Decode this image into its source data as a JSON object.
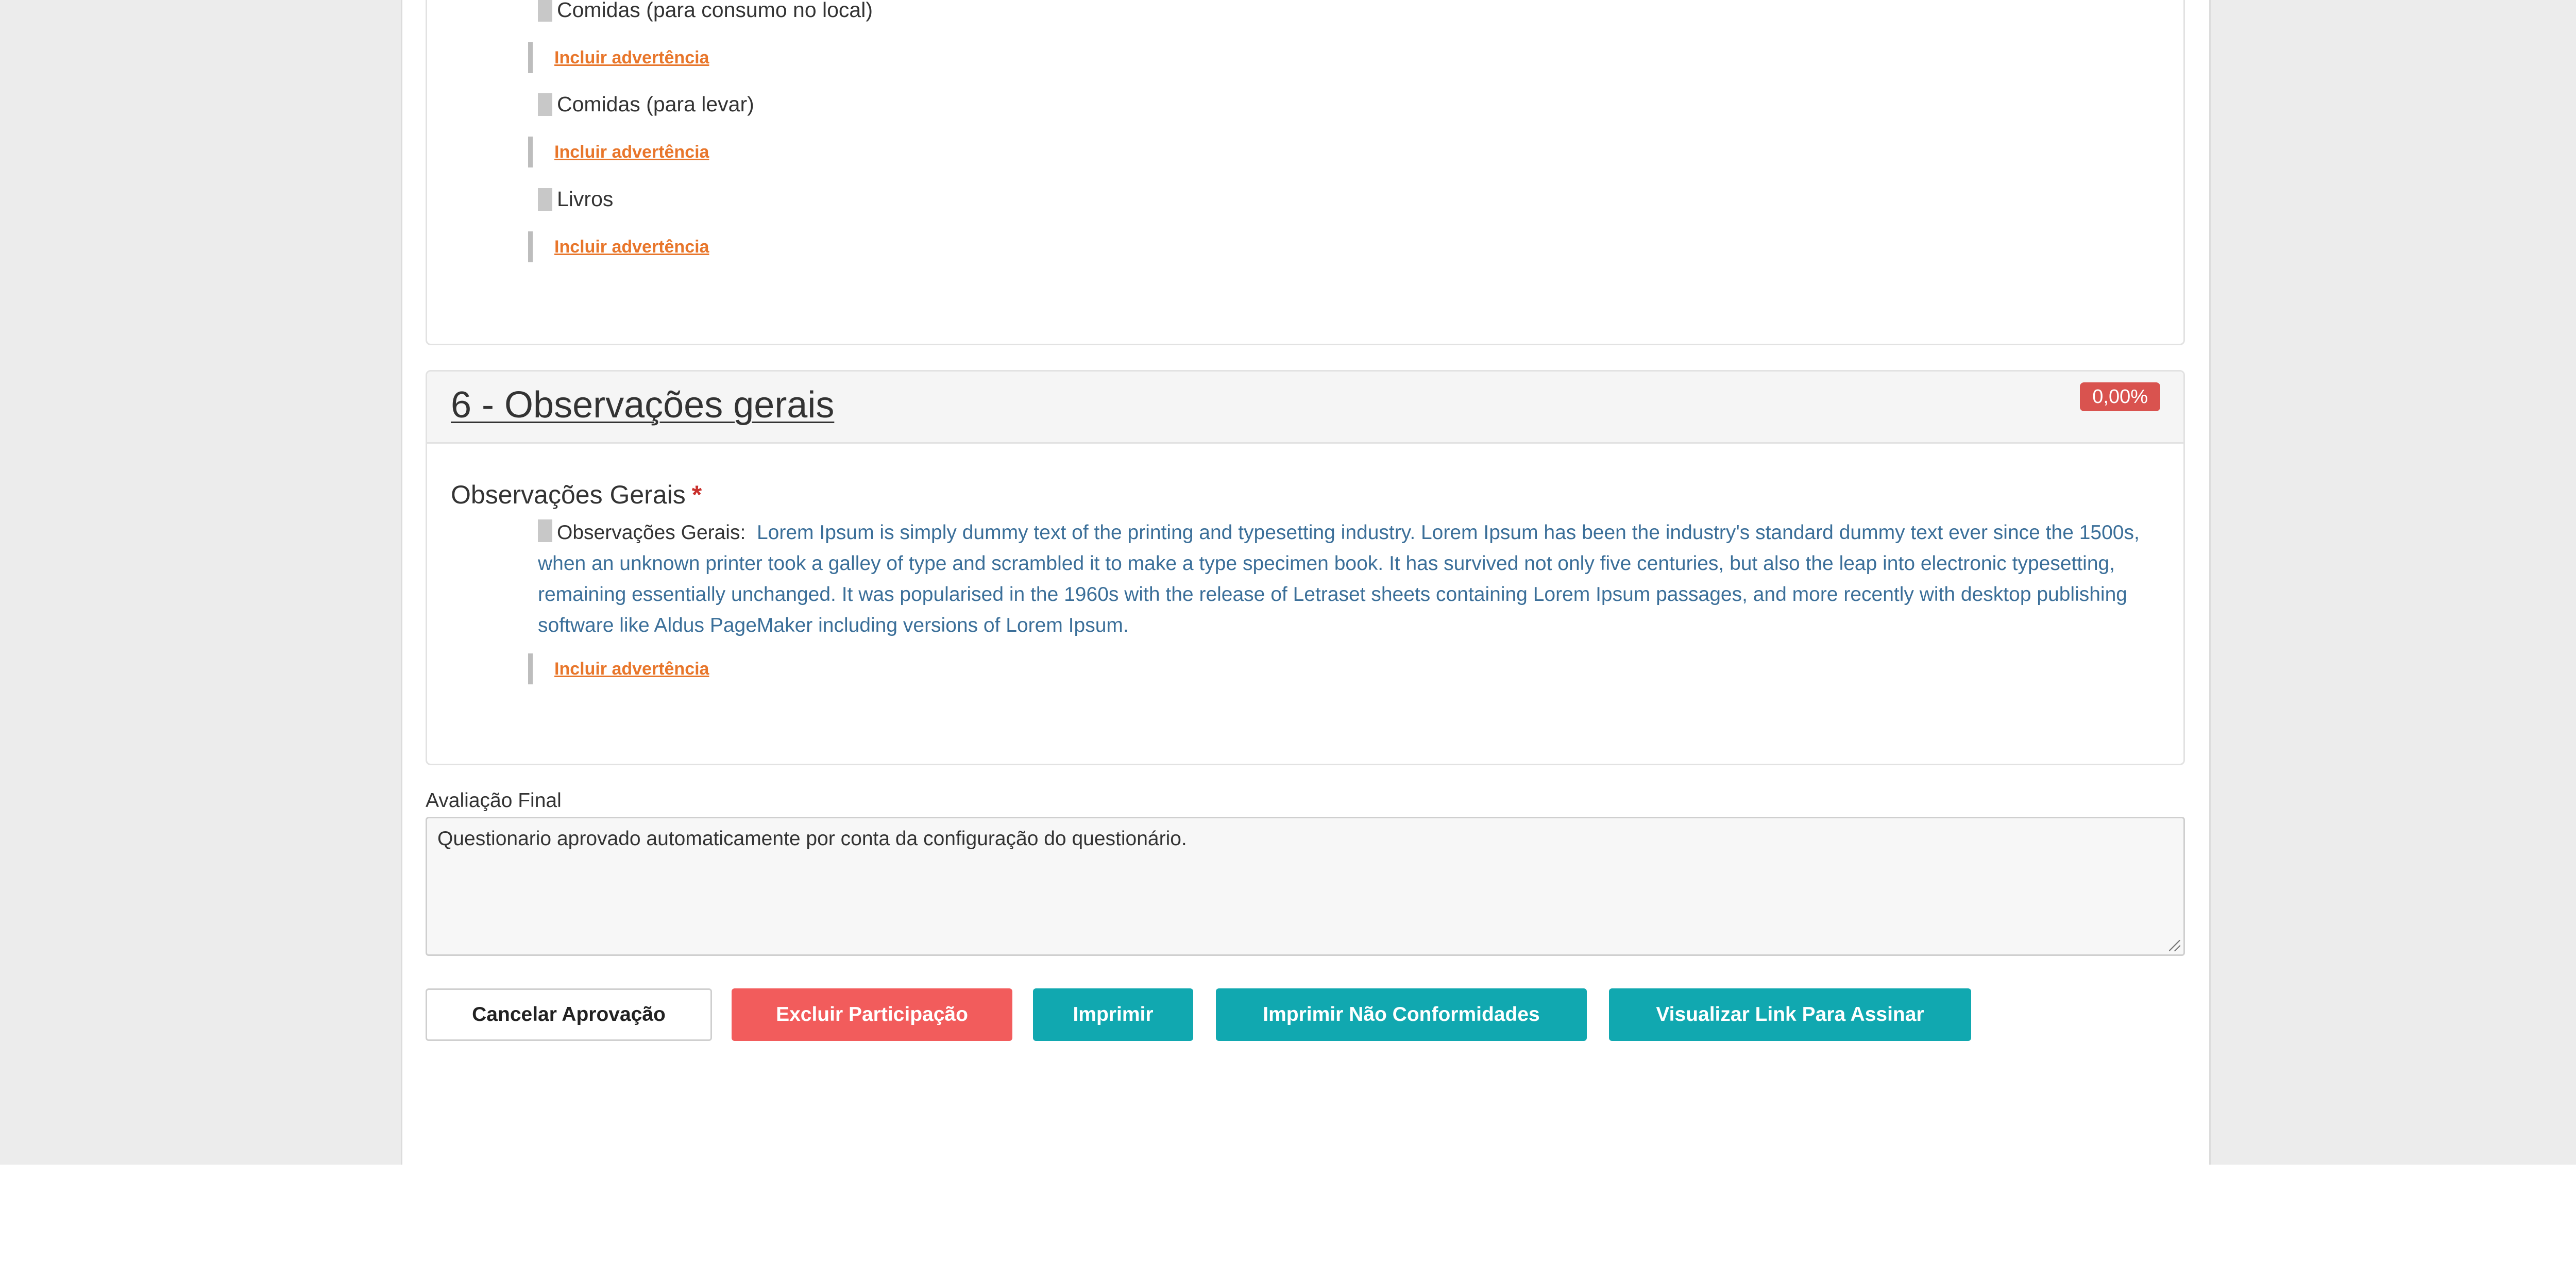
{
  "section5": {
    "items": [
      {
        "label": "Comidas (para consumo no local)",
        "warning_link": "Incluir advertência"
      },
      {
        "label": "Comidas (para levar)",
        "warning_link": "Incluir advertência"
      },
      {
        "label": "Livros",
        "warning_link": "Incluir advertência"
      }
    ]
  },
  "section6": {
    "title": "6 - Observações gerais",
    "score_badge": "0,00%",
    "field_label": "Observações Gerais",
    "required_mark": "*",
    "answer_prefix": "Observações Gerais:",
    "answer_text": "Lorem Ipsum is simply dummy text of the printing and typesetting industry. Lorem Ipsum has been the industry's standard dummy text ever since the 1500s, when an unknown printer took a galley of type and scrambled it to make a type specimen book. It has survived not only five centuries, but also the leap into electronic typesetting, remaining essentially unchanged. It was popularised in the 1960s with the release of Letraset sheets containing Lorem Ipsum passages, and more recently with desktop publishing software like Aldus PageMaker including versions of Lorem Ipsum.",
    "warning_link": "Incluir advertência"
  },
  "final_evaluation": {
    "label": "Avaliação Final",
    "value": "Questionario aprovado automaticamente por conta da configuração do questionário."
  },
  "buttons": {
    "cancel_approval": "Cancelar Aprovação",
    "delete_participation": "Excluir Participação",
    "print": "Imprimir",
    "print_nonconformities": "Imprimir Não Conformidades",
    "view_sign_link": "Visualizar Link Para Assinar"
  },
  "colors": {
    "badge_red": "#d9534f",
    "warning_orange": "#e8762b",
    "delete_red": "#f25c5c",
    "teal": "#11a8b0",
    "answer_blue": "#3b6f99"
  }
}
